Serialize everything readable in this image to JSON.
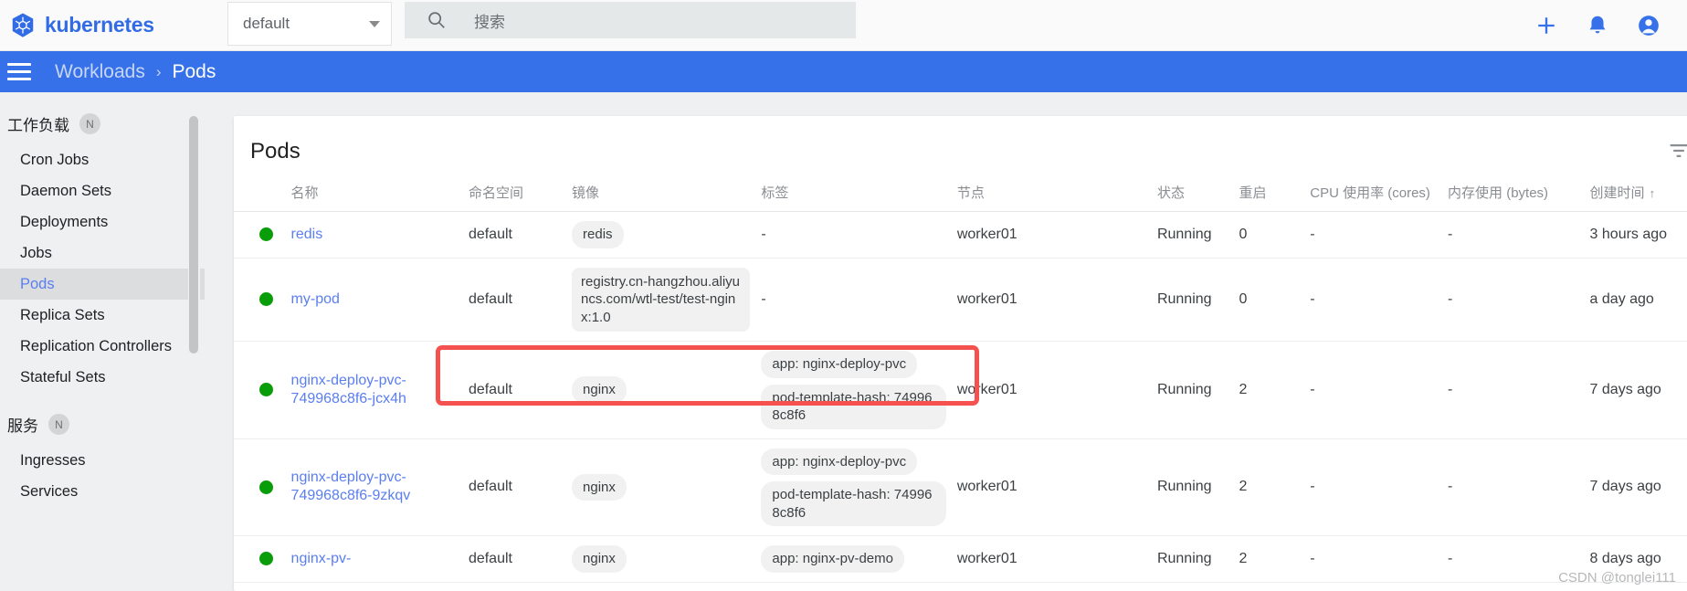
{
  "topbar": {
    "brand": "kubernetes",
    "logo_icon": "kubernetes-helm-icon",
    "namespace_selected": "default",
    "namespace_caret_icon": "chevron-down-icon",
    "search_icon": "search-icon",
    "search_placeholder": "搜索",
    "search_value": "",
    "add_icon": "plus-icon",
    "notifications_icon": "bell-icon",
    "account_icon": "account-circle-icon"
  },
  "breadcrumb": {
    "menu_icon": "hamburger-menu-icon",
    "parent": "Workloads",
    "separator": "›",
    "current": "Pods"
  },
  "sidebar": {
    "sections": [
      {
        "label": "工作负载",
        "badge": "N",
        "items": [
          {
            "label": "Cron Jobs",
            "active": false
          },
          {
            "label": "Daemon Sets",
            "active": false
          },
          {
            "label": "Deployments",
            "active": false
          },
          {
            "label": "Jobs",
            "active": false
          },
          {
            "label": "Pods",
            "active": true
          },
          {
            "label": "Replica Sets",
            "active": false
          },
          {
            "label": "Replication Controllers",
            "active": false
          },
          {
            "label": "Stateful Sets",
            "active": false
          }
        ]
      },
      {
        "label": "服务",
        "badge": "N",
        "items": [
          {
            "label": "Ingresses",
            "active": false
          },
          {
            "label": "Services",
            "active": false
          }
        ]
      }
    ]
  },
  "main": {
    "card_title": "Pods",
    "filter_icon": "filter-list-icon",
    "columns": [
      "名称",
      "命名空间",
      "镜像",
      "标签",
      "节点",
      "状态",
      "重启",
      "CPU 使用率 (cores)",
      "内存使用 (bytes)",
      "创建时间"
    ],
    "sort_column": "创建时间",
    "sort_arrow": "↑",
    "rows": [
      {
        "status": "ok",
        "name": "redis",
        "namespace": "default",
        "images": [
          "redis"
        ],
        "labels": [],
        "labels_empty": "-",
        "node": "worker01",
        "state": "Running",
        "restarts": "0",
        "cpu": "-",
        "memory": "-",
        "created": "3 hours ago"
      },
      {
        "status": "ok",
        "name": "my-pod",
        "namespace": "default",
        "images": [
          "registry.cn-hangzhou.aliyuncs.com/wtl-test/test-nginx:1.0"
        ],
        "labels": [],
        "labels_empty": "-",
        "node": "worker01",
        "state": "Running",
        "restarts": "0",
        "cpu": "-",
        "memory": "-",
        "created": "a day ago",
        "highlighted": true
      },
      {
        "status": "ok",
        "name": "nginx-deploy-pvc-749968c8f6-jcx4h",
        "namespace": "default",
        "images": [
          "nginx"
        ],
        "labels": [
          "app: nginx-deploy-pvc",
          "pod-template-hash: 749968c8f6"
        ],
        "labels_empty": "",
        "node": "worker01",
        "state": "Running",
        "restarts": "2",
        "cpu": "-",
        "memory": "-",
        "created": "7 days ago"
      },
      {
        "status": "ok",
        "name": "nginx-deploy-pvc-749968c8f6-9zkqv",
        "namespace": "default",
        "images": [
          "nginx"
        ],
        "labels": [
          "app: nginx-deploy-pvc",
          "pod-template-hash: 749968c8f6"
        ],
        "labels_empty": "",
        "node": "worker01",
        "state": "Running",
        "restarts": "2",
        "cpu": "-",
        "memory": "-",
        "created": "7 days ago"
      },
      {
        "status": "ok",
        "name": "nginx-pv-",
        "namespace": "default",
        "images": [
          "nginx"
        ],
        "labels": [
          "app: nginx-pv-demo"
        ],
        "labels_empty": "",
        "node": "worker01",
        "state": "Running",
        "restarts": "2",
        "cpu": "-",
        "memory": "-",
        "created": "8 days ago"
      }
    ]
  },
  "watermark": "CSDN @tonglei111",
  "colors": {
    "brand_blue": "#326ce5",
    "header_blue": "#3671e9",
    "link_blue": "#5b7ef0",
    "status_green": "#0a9d0a",
    "annotation_red": "#f4514f"
  }
}
